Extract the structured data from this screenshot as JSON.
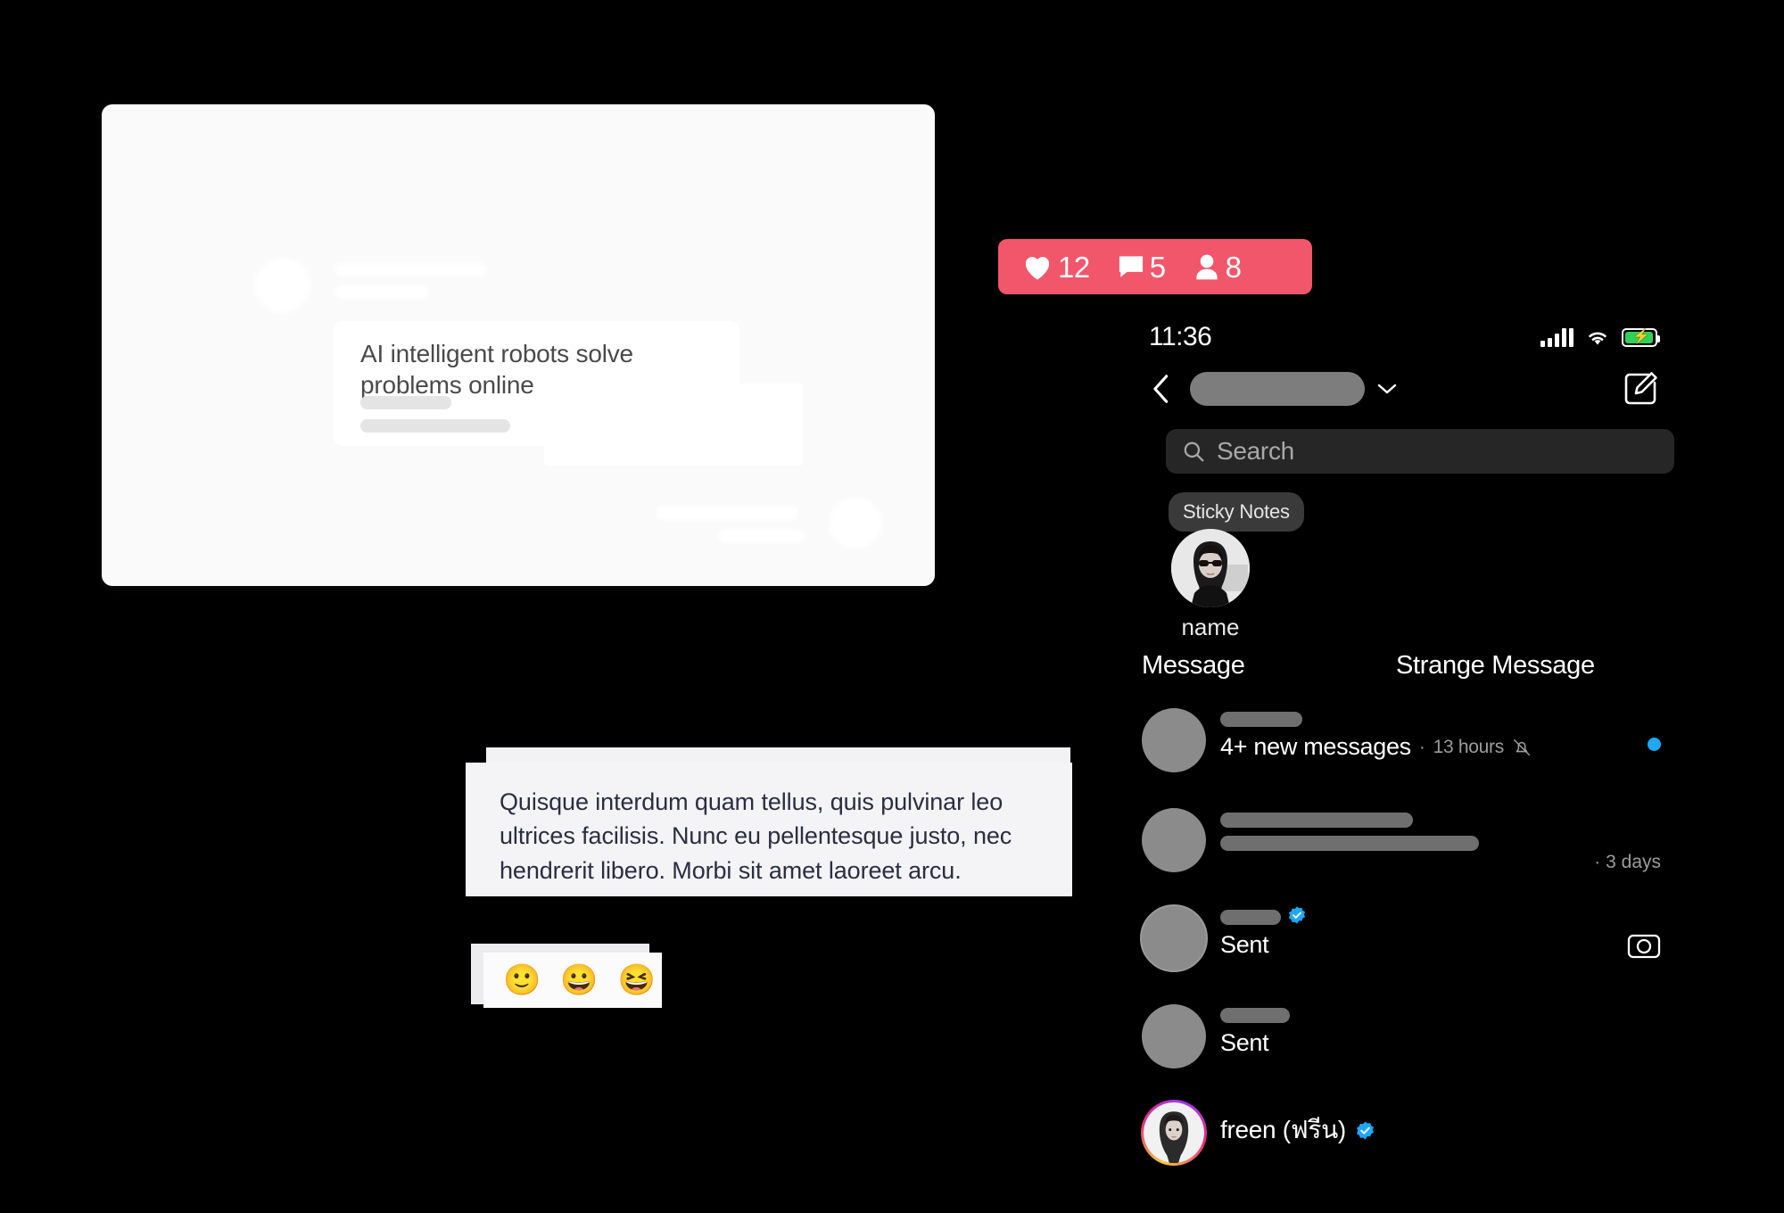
{
  "left_card": {
    "message_text": "AI intelligent robots solve problems online",
    "robot_icon": "robot-icon"
  },
  "lorem_card": {
    "text": "Quisque interdum quam tellus, quis pulvinar leo ultrices facilisis. Nunc eu pellentesque justo, nec hendrerit libero. Morbi sit amet laoreet arcu."
  },
  "emoji_card": {
    "emojis": [
      "🙂",
      "😀",
      "😆"
    ]
  },
  "engagement_badge": {
    "background": "#f2566a",
    "likes": "12",
    "comments": "5",
    "followers": "8",
    "like_icon": "heart-icon",
    "comment_icon": "comment-bubble-icon",
    "follower_icon": "person-icon"
  },
  "status_bar": {
    "time": "11:36",
    "signal_icon": "cellular-signal-icon",
    "wifi_icon": "wifi-icon",
    "battery_icon": "battery-charging-icon",
    "battery_color": "#30d158"
  },
  "nav": {
    "back_icon": "back-chevron-icon",
    "account_chevron_icon": "chevron-down-icon",
    "compose_icon": "compose-icon"
  },
  "search": {
    "placeholder": "Search",
    "icon": "search-icon"
  },
  "notes": {
    "sticky_label": "Sticky Notes",
    "avatar": "user-avatar",
    "name": "name"
  },
  "tabs": [
    {
      "label": "Message"
    },
    {
      "label": "Strange Message"
    }
  ],
  "conversations": [
    {
      "subtitle": "4+ new messages",
      "meta": "13 hours",
      "separator": "·",
      "muted_icon": "bell-muted-icon",
      "unread": true
    },
    {
      "meta": "· 3 days"
    },
    {
      "subtitle": "Sent",
      "verified": true,
      "camera_icon": "camera-icon"
    },
    {
      "subtitle": "Sent"
    },
    {
      "name": "freen (ฟรีน)",
      "verified": true,
      "story_ring": true
    }
  ],
  "colors": {
    "unread_dot": "#1fa8f5",
    "verified_badge": "#1fa8f5",
    "accent_badge": "#f2566a",
    "background": "#000000"
  }
}
